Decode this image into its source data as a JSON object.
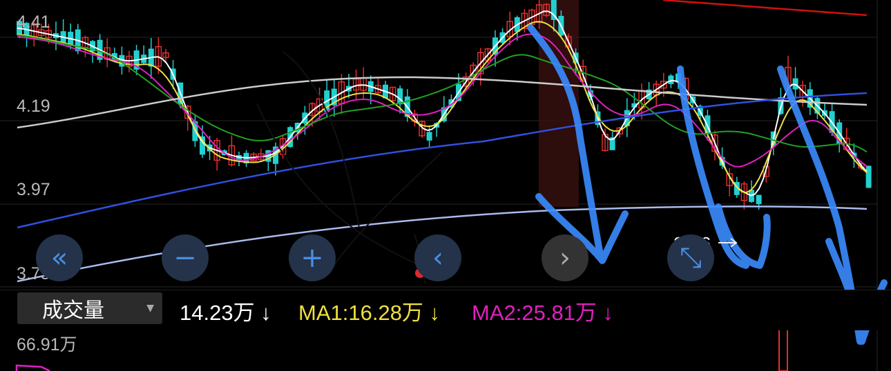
{
  "price_axis": [
    "4.41",
    "4.19",
    "3.97",
    "3.75"
  ],
  "last_price": "3.86",
  "nav_buttons": [
    {
      "name": "scroll-left-fast-button",
      "glyph": "«",
      "style": "blue"
    },
    {
      "name": "zoom-out-button",
      "glyph": "−",
      "style": "blue"
    },
    {
      "name": "zoom-in-button",
      "glyph": "+",
      "style": "blue"
    },
    {
      "name": "scroll-left-button",
      "glyph": "‹",
      "style": "blue"
    },
    {
      "name": "scroll-right-button",
      "glyph": "›",
      "style": "gray"
    },
    {
      "name": "fullscreen-button",
      "glyph": "⤡",
      "style": "blue"
    }
  ],
  "indicator": {
    "selector_label": "成交量",
    "volume": "14.23万 ↓",
    "ma1": "MA1:16.28万 ↓",
    "ma2": "MA2:25.81万 ↓",
    "volume_axis_max": "66.91万"
  },
  "colors": {
    "up": "#e03030",
    "down": "#22d0d0",
    "ma_white": "#ffffff",
    "ma_yellow": "#f0e040",
    "ma_magenta": "#e020c0",
    "ma_green": "#22a022",
    "ma_gray": "#cccccc",
    "ma_blue": "#3050e0",
    "ma_light": "#aabbee",
    "ma_red": "#d01010",
    "annotation_blue": "#3a8cff"
  }
}
